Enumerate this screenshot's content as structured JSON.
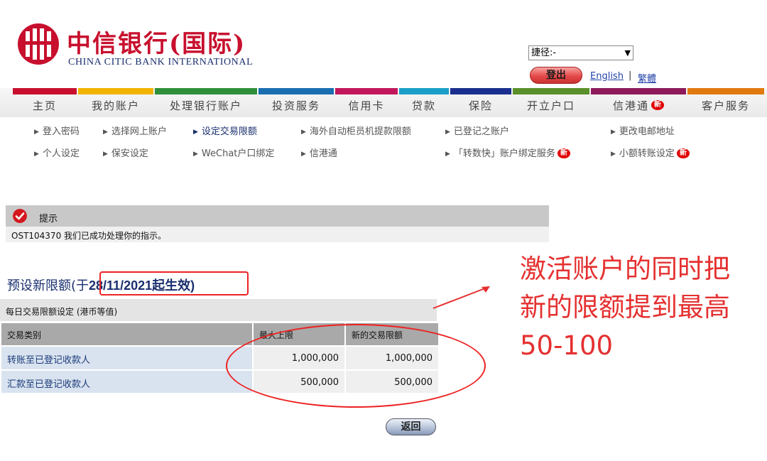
{
  "header": {
    "logo_cn": "中信银行(国际)",
    "logo_en": "CHINA CITIC BANK INTERNATIONAL",
    "shortcut_select": "捷径:-",
    "logout_label": "登出",
    "lang_english": "English",
    "lang_separator": "|",
    "lang_traditional": "繁體"
  },
  "nav": {
    "items": [
      {
        "label": "主页",
        "stripe": "#c8102e"
      },
      {
        "label": "我的账户",
        "stripe": "#f0b400"
      },
      {
        "label": "处理银行账户",
        "stripe": "#2f8f3a"
      },
      {
        "label": "投资服务",
        "stripe": "#1a6fb0"
      },
      {
        "label": "信用卡",
        "stripe": "#c2185b"
      },
      {
        "label": "贷款",
        "stripe": "#1aa0c8"
      },
      {
        "label": "保险",
        "stripe": "#1a2f8e"
      },
      {
        "label": "开立户口",
        "stripe": "#5a8f2a"
      },
      {
        "label": "信港通",
        "stripe": "#8e1a5a",
        "badge": "新"
      },
      {
        "label": "客户服务",
        "stripe": "#e07a10"
      }
    ],
    "badge_new": "新"
  },
  "subnav": {
    "row1": [
      "登入密码",
      "选择网上账户",
      "设定交易限额",
      "海外自动柜员机提款限额",
      "已登记之账户",
      "更改电邮地址"
    ],
    "row2": [
      "个人设定",
      "保安设定",
      "WeChat户口绑定",
      "信港通",
      "「转数快」账户绑定服务",
      "小额转账设定"
    ]
  },
  "notice": {
    "title": "提示",
    "message": "OST104370 我们已成功处理你的指示。"
  },
  "section": {
    "title_prefix": "预设新限额(于",
    "title_date": "28/11/2021",
    "title_suffix": "起生效)"
  },
  "limits_table": {
    "caption": "每日交易限额设定 (港币等值)",
    "headers": [
      "交易类别",
      "最大上限",
      "新的交易限额"
    ],
    "rows": [
      {
        "type": "转账至已登记收款人",
        "max": "1,000,000",
        "new": "1,000,000"
      },
      {
        "type": "汇款至已登记收款人",
        "max": "500,000",
        "new": "500,000"
      }
    ]
  },
  "back_label": "返回",
  "annotation": {
    "line1": "激活账户的同时把",
    "line2": "新的限额提到最高",
    "line3": "50-100"
  },
  "colors": {
    "brand_red": "#c8102e",
    "brand_navy": "#1a2f6e",
    "annotation_red": "#e53030"
  }
}
